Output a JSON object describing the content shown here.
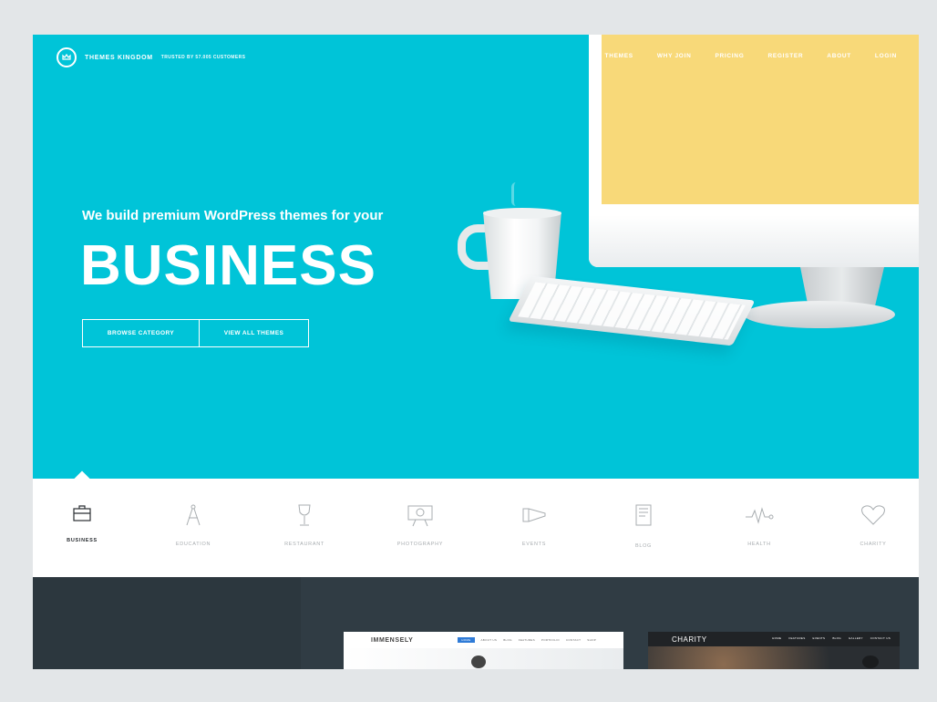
{
  "brand": {
    "name": "THEMES KINGDOM",
    "tagline": "TRUSTED BY 57.005 CUSTOMERS"
  },
  "nav": [
    "THEMES",
    "WHY JOIN",
    "PRICING",
    "REGISTER",
    "ABOUT",
    "LOGIN"
  ],
  "hero": {
    "intro": "We build premium WordPress themes for your",
    "headline": "BUSINESS",
    "buttons": [
      "BROWSE CATEGORY",
      "VIEW ALL THEMES"
    ]
  },
  "categories": [
    {
      "label": "BUSINESS",
      "icon": "briefcase-icon",
      "active": true
    },
    {
      "label": "EDUCATION",
      "icon": "compass-icon",
      "active": false
    },
    {
      "label": "RESTAURANT",
      "icon": "wine-glass-icon",
      "active": false
    },
    {
      "label": "PHOTOGRAPHY",
      "icon": "projector-icon",
      "active": false
    },
    {
      "label": "EVENTS",
      "icon": "megaphone-icon",
      "active": false
    },
    {
      "label": "BLOG",
      "icon": "document-icon",
      "active": false
    },
    {
      "label": "HEALTH",
      "icon": "heartbeat-icon",
      "active": false
    },
    {
      "label": "CHARITY",
      "icon": "heart-icon",
      "active": false
    }
  ],
  "previews": {
    "immensely": {
      "logo": "IMMENSELY",
      "menu": [
        "HOME",
        "ABOUT US",
        "BLOG",
        "FEATURES",
        "PORTFOLIO",
        "CONTACT",
        "SHOP"
      ]
    },
    "charity": {
      "logo": "CHARITY",
      "menu": [
        "HOME",
        "FEATURES",
        "EVENTS",
        "BLOG",
        "GALLERY",
        "CONTACT US"
      ]
    }
  },
  "colors": {
    "hero_bg": "#00c4d8",
    "screen": "#f8d979",
    "dark_section": "#303c44",
    "active_menu": "#2f7bd7"
  }
}
